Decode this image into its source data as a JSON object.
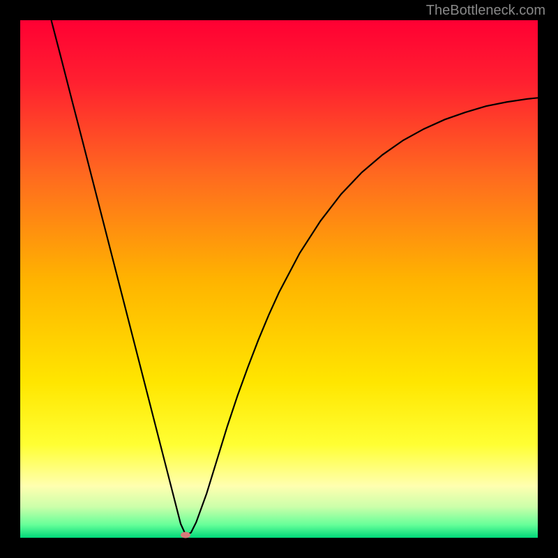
{
  "watermark": "TheBottleneck.com",
  "chart_data": {
    "type": "line",
    "title": "",
    "xlabel": "",
    "ylabel": "",
    "xlim": [
      0,
      100
    ],
    "ylim": [
      0,
      100
    ],
    "grid": false,
    "legend": false,
    "background_gradient": {
      "stops": [
        {
          "pos": 0.0,
          "color": "#ff0033"
        },
        {
          "pos": 0.12,
          "color": "#ff2030"
        },
        {
          "pos": 0.3,
          "color": "#ff6a1f"
        },
        {
          "pos": 0.5,
          "color": "#ffb300"
        },
        {
          "pos": 0.7,
          "color": "#ffe600"
        },
        {
          "pos": 0.82,
          "color": "#ffff33"
        },
        {
          "pos": 0.9,
          "color": "#ffffb0"
        },
        {
          "pos": 0.94,
          "color": "#ccffaa"
        },
        {
          "pos": 0.975,
          "color": "#66ff99"
        },
        {
          "pos": 1.0,
          "color": "#00d97a"
        }
      ]
    },
    "series": [
      {
        "name": "bottleneck-curve",
        "color": "#000000",
        "x": [
          6,
          8,
          10,
          12,
          14,
          16,
          18,
          20,
          22,
          24,
          26,
          28,
          30,
          31,
          32,
          33,
          34,
          36,
          38,
          40,
          42,
          44,
          46,
          48,
          50,
          54,
          58,
          62,
          66,
          70,
          74,
          78,
          82,
          86,
          90,
          94,
          98,
          100
        ],
        "y": [
          100,
          92.3,
          84.5,
          76.8,
          69.0,
          61.2,
          53.4,
          45.6,
          37.8,
          30.0,
          22.2,
          14.4,
          6.6,
          2.7,
          0.5,
          1.0,
          3.0,
          8.5,
          15.0,
          21.5,
          27.5,
          33.0,
          38.2,
          43.0,
          47.4,
          55.0,
          61.2,
          66.4,
          70.6,
          74.0,
          76.8,
          79.0,
          80.8,
          82.2,
          83.4,
          84.2,
          84.8,
          85.0
        ]
      }
    ],
    "marker": {
      "x": 32,
      "y": 0.5,
      "color": "#d77a7a"
    }
  }
}
